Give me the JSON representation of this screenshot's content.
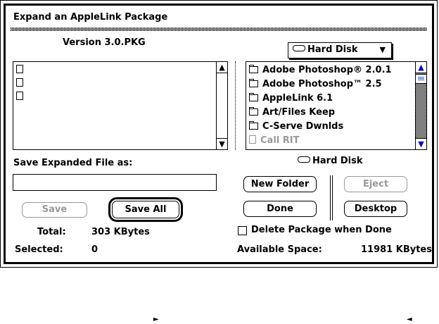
{
  "dialog": {
    "title": "Expand an AppleLink Package",
    "package_name": "Version 3.0.PKG",
    "left_list": {
      "items": [
        "",
        "",
        ""
      ]
    },
    "volume_popup": "Hard Disk",
    "right_list": {
      "items": [
        {
          "label": "Adobe Photoshop® 2.0.1",
          "kind": "folder",
          "enabled": true
        },
        {
          "label": "Adobe Photoshop™ 2.5",
          "kind": "folder",
          "enabled": true
        },
        {
          "label": "AppleLink 6.1",
          "kind": "folder",
          "enabled": true
        },
        {
          "label": "Art/Files Keep",
          "kind": "folder",
          "enabled": true
        },
        {
          "label": "C-Serve Dwnlds",
          "kind": "folder",
          "enabled": true
        },
        {
          "label": "Call RIT",
          "kind": "file",
          "enabled": false
        }
      ]
    },
    "save_as_label": "Save Expanded File as:",
    "save_as_value": "",
    "volume_label": "Hard Disk",
    "buttons": {
      "save": "Save",
      "save_all": "Save All",
      "new_folder": "New Folder",
      "eject": "Eject",
      "done": "Done",
      "desktop": "Desktop"
    },
    "delete_checkbox_label": "Delete Package when Done",
    "delete_checked": false,
    "total_label": "Total:",
    "total_value": "303 KBytes",
    "selected_label": "Selected:",
    "selected_value": "0",
    "available_label": "Available Space:",
    "available_value": "11981 KBytes"
  },
  "markers": {
    "left": "►",
    "right": "◄"
  },
  "icons": [
    "doc-icon",
    "folder-icon",
    "disk-icon",
    "up-arrow-icon",
    "down-arrow-icon",
    "popup-triangle-icon",
    "checkbox-icon"
  ]
}
